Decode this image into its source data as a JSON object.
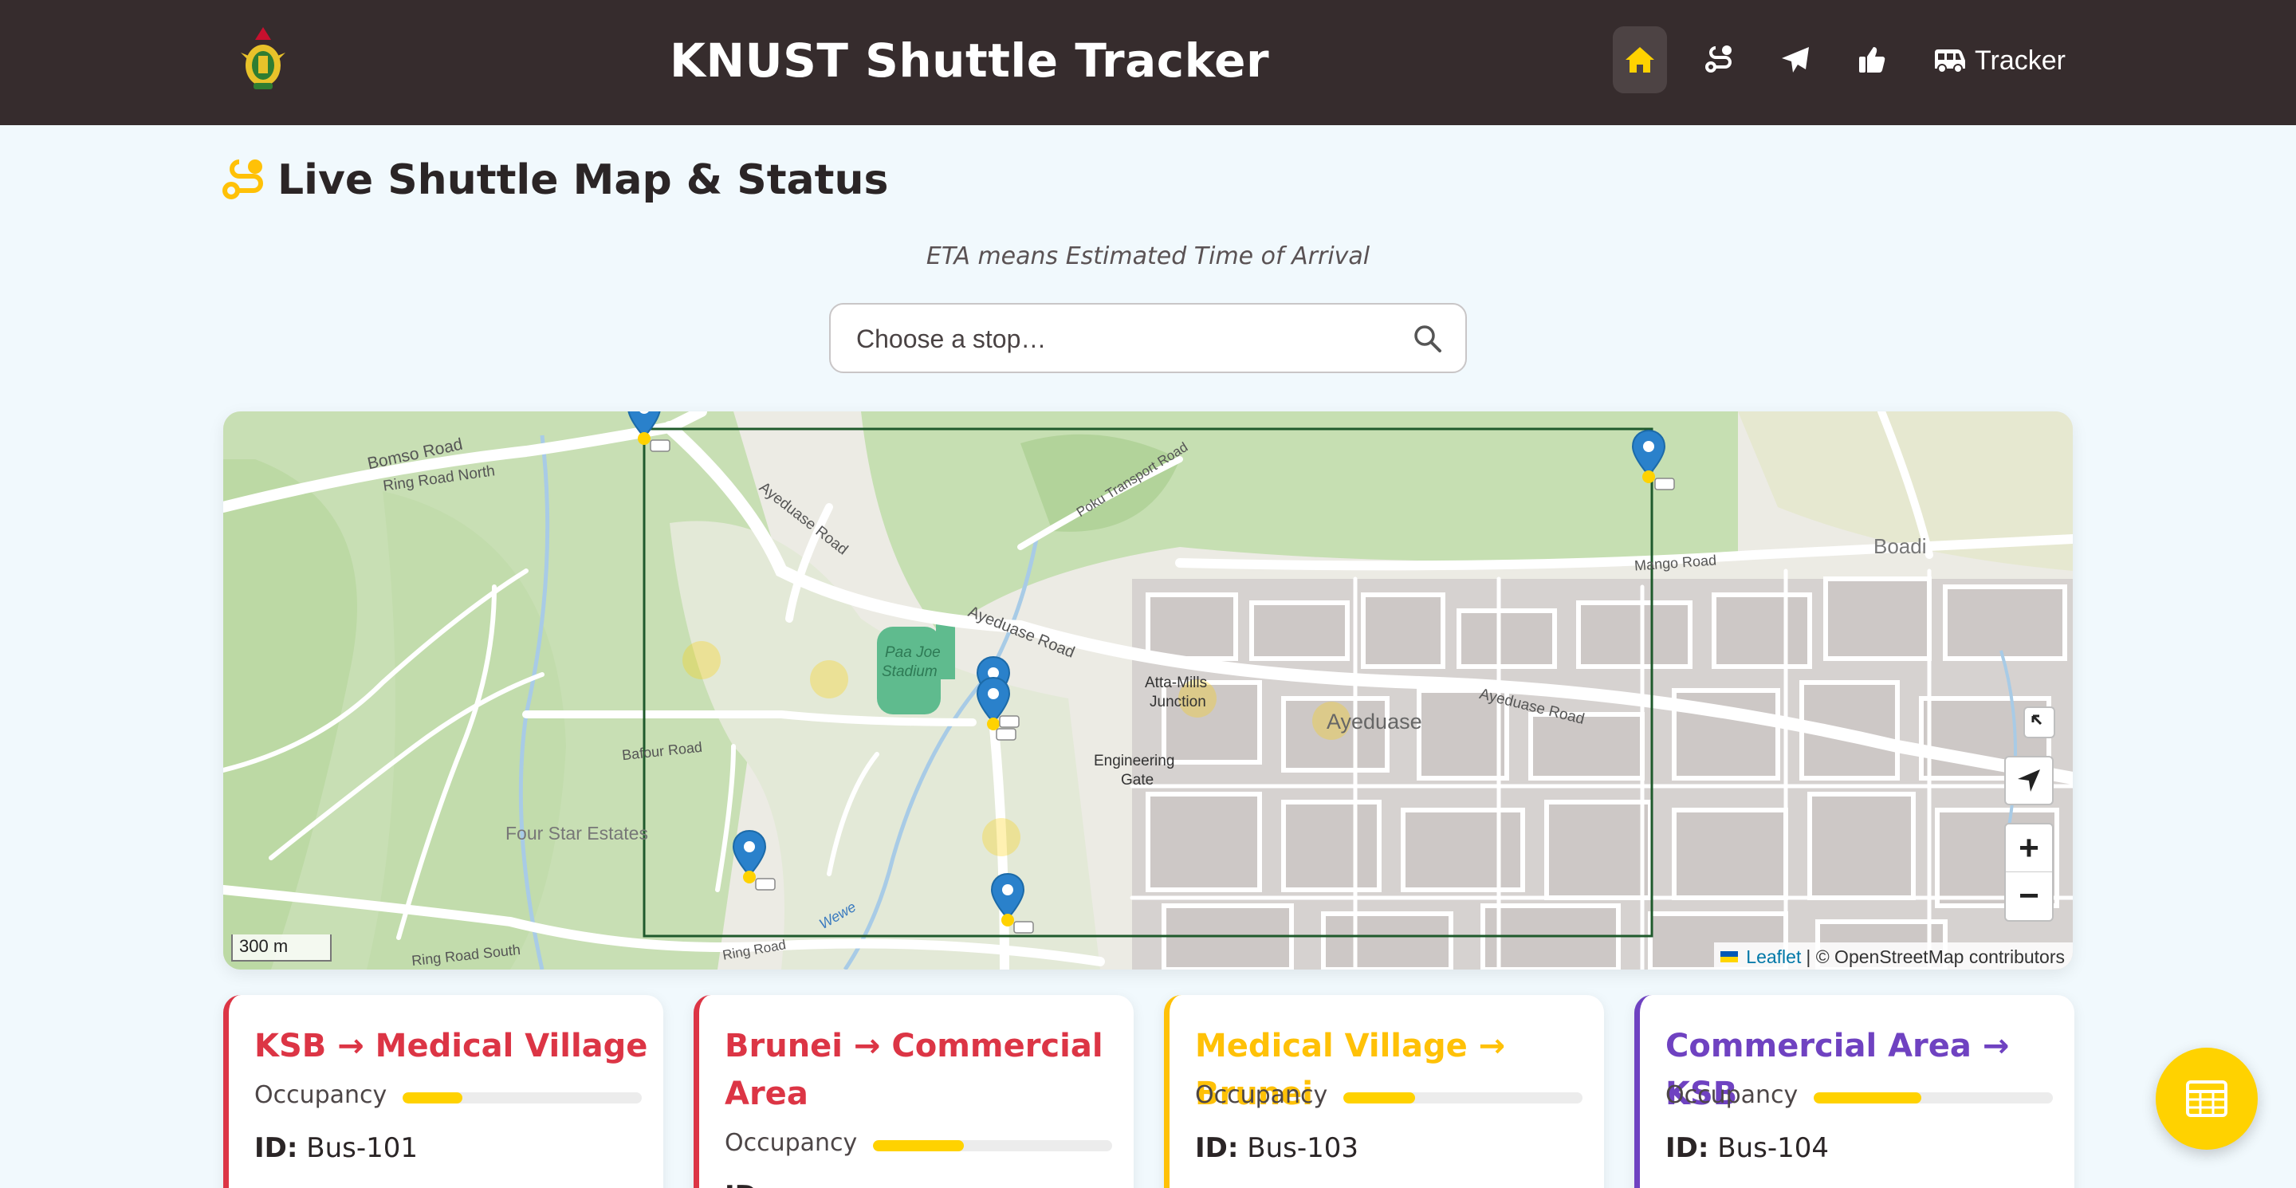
{
  "header": {
    "title": "KNUST Shuttle Tracker",
    "nav": {
      "home_icon": "home-icon",
      "route_icon": "route-icon",
      "send_icon": "paper-plane-icon",
      "feedback_icon": "thumbs-up-icon",
      "tracker_label": "Tracker",
      "tracker_icon": "van-icon"
    }
  },
  "section": {
    "title": "Live Shuttle Map & Status",
    "icon": "route-icon",
    "eta_note": "ETA means Estimated Time of Arrival"
  },
  "search": {
    "placeholder": "Choose a stop…"
  },
  "map": {
    "labels": {
      "bomso_road": "Bomso Road",
      "ring_road_north": "Ring Road North",
      "ayeduase_road": "Ayeduase Road",
      "poku_transport_road": "Poku Transport Road",
      "mango_road": "Mango Road",
      "boadi": "Boadi",
      "paa_joe": "Paa Joe",
      "stadium": "Stadium",
      "atta_mills": "Atta-Mills",
      "junction": "Junction",
      "ayeduase": "Ayeduase",
      "engineering": "Engineering",
      "gate": "Gate",
      "four_star_estates": "Four Star Estates",
      "bafour_road": "Bafour Road",
      "ring_road_south": "Ring Road South",
      "wewe": "Wewe",
      "ring_road": "Ring Road"
    },
    "scale": "300 m",
    "attribution_link": "Leaflet",
    "attribution_text": "| © OpenStreetMap contributors",
    "zoom_in": "+",
    "zoom_out": "−",
    "colors": {
      "route_box": "#1f5a2c",
      "marker": "#2a81cb",
      "stop_dot": "#ffd200"
    }
  },
  "routes": [
    {
      "title": "KSB → Medical Village",
      "color": "#dc3545",
      "occupancy_label": "Occupancy",
      "occupancy": 0.25,
      "id_label": "ID:",
      "id": "Bus-101"
    },
    {
      "title": "Brunei → Commercial Area",
      "color": "#dc3545",
      "occupancy_label": "Occupancy",
      "occupancy": 0.38,
      "id_label": "ID:",
      "id": ""
    },
    {
      "title": "Medical Village → Brunei",
      "color": "#ffc107",
      "occupancy_label": "Occupancy",
      "occupancy": 0.3,
      "id_label": "ID:",
      "id": "Bus-103"
    },
    {
      "title": "Commercial Area → KSB",
      "color": "#6f42c1",
      "occupancy_label": "Occupancy",
      "occupancy": 0.45,
      "id_label": "ID:",
      "id": "Bus-104"
    }
  ],
  "fab": {
    "icon": "table-grid-icon"
  }
}
